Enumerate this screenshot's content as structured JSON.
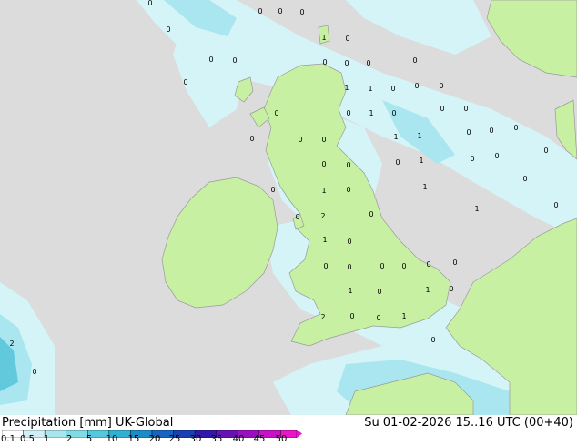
{
  "header": {
    "product": "Precipitation [mm]",
    "model": "UK-Global",
    "valid": "Su 01-02-2026 15..16 UTC (00+40)"
  },
  "legend": {
    "ticks": [
      "0.1",
      "0.5",
      "1",
      "2",
      "5",
      "10",
      "15",
      "20",
      "25",
      "30",
      "35",
      "40",
      "45",
      "50"
    ],
    "colors": [
      "#ffffff",
      "#cfeff5",
      "#a7e6ee",
      "#7fdbe6",
      "#55c8dd",
      "#2fb1d3",
      "#1b8cc8",
      "#1664bf",
      "#1a3fb3",
      "#3217a8",
      "#6611b3",
      "#9a0fc0",
      "#c812c6",
      "#e816c8"
    ]
  },
  "map": {
    "sea_color": "#dcdcdc",
    "land_color": "#c7f0a3",
    "precip_light": "#d5f4f7",
    "precip_medium": "#a9e6ef",
    "precip_heavy": "#62c9dd",
    "coast_color": "#9a9a9a",
    "labels": [
      {
        "text": "0"
      },
      {
        "text": "0"
      },
      {
        "text": "0"
      },
      {
        "text": "0"
      },
      {
        "text": "0"
      },
      {
        "text": "0"
      },
      {
        "text": "1"
      },
      {
        "text": "0"
      },
      {
        "text": "0"
      },
      {
        "text": "0"
      },
      {
        "text": "0"
      },
      {
        "text": "0"
      },
      {
        "text": "0"
      },
      {
        "text": "0"
      },
      {
        "text": "1"
      },
      {
        "text": "1"
      },
      {
        "text": "0"
      },
      {
        "text": "0"
      },
      {
        "text": "0"
      },
      {
        "text": "0"
      },
      {
        "text": "1"
      },
      {
        "text": "0"
      },
      {
        "text": "0"
      },
      {
        "text": "0"
      },
      {
        "text": "0"
      },
      {
        "text": "0"
      },
      {
        "text": "0"
      },
      {
        "text": "0"
      },
      {
        "text": "1"
      },
      {
        "text": "1"
      },
      {
        "text": "0"
      },
      {
        "text": "0"
      },
      {
        "text": "0"
      },
      {
        "text": "0"
      },
      {
        "text": "1"
      },
      {
        "text": "0"
      },
      {
        "text": "0"
      },
      {
        "text": "0"
      },
      {
        "text": "0"
      },
      {
        "text": "0"
      },
      {
        "text": "0"
      },
      {
        "text": "1"
      },
      {
        "text": "1"
      },
      {
        "text": "0"
      },
      {
        "text": "0"
      },
      {
        "text": "2"
      },
      {
        "text": "0"
      },
      {
        "text": "1"
      },
      {
        "text": "0"
      },
      {
        "text": "1"
      },
      {
        "text": "0"
      },
      {
        "text": "0"
      },
      {
        "text": "0"
      },
      {
        "text": "0"
      },
      {
        "text": "0"
      },
      {
        "text": "0"
      },
      {
        "text": "0"
      },
      {
        "text": "0"
      },
      {
        "text": "1"
      },
      {
        "text": "0"
      },
      {
        "text": "1"
      },
      {
        "text": "0"
      },
      {
        "text": "0"
      },
      {
        "text": "2"
      },
      {
        "text": "0"
      },
      {
        "text": "1"
      },
      {
        "text": "0"
      },
      {
        "text": "2"
      },
      {
        "text": "0"
      }
    ]
  }
}
